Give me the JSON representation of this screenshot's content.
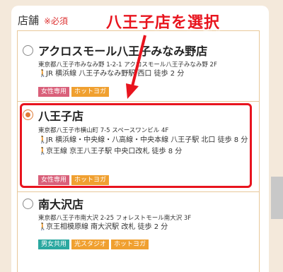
{
  "header": {
    "label": "店舗",
    "required": "※必須"
  },
  "annotation": {
    "text": "八王子店を選択",
    "color": "#e8141e"
  },
  "stores": [
    {
      "name": "アクロスモール八王子みなみ野店",
      "address": "東京都八王子市みなみ野 1-2-1 アクロスモール八王子みなみ野 2F",
      "access": [
        "JR 横浜線 八王子みなみ野駅 西口 徒歩 2 分"
      ],
      "tags": [
        {
          "label": "女性専用",
          "color": "#d9607a"
        },
        {
          "label": "ホットヨガ",
          "color": "#f0a030"
        }
      ],
      "selected": false
    },
    {
      "name": "八王子店",
      "address": "東京都八王子市横山町 7-5 スペースワンビル 4F",
      "access": [
        "JR 横浜線・中央線・八高線・中央本線 八王子駅 北口 徒歩 8 分",
        "京王線 京王八王子駅 中央口改札 徒歩 8 分"
      ],
      "tags": [
        {
          "label": "女性専用",
          "color": "#d9607a"
        },
        {
          "label": "ホットヨガ",
          "color": "#f0a030"
        }
      ],
      "selected": true
    },
    {
      "name": "南大沢店",
      "address": "東京都八王子市南大沢 2-25 フォレストモール南大沢 3F",
      "access": [
        "京王相模原線 南大沢駅 改札 徒歩 2 分"
      ],
      "tags": [
        {
          "label": "男女共用",
          "color": "#2aa8a0"
        },
        {
          "label": "光スタジオ",
          "color": "#f0a030"
        },
        {
          "label": "ホットヨガ",
          "color": "#f0a030"
        }
      ],
      "selected": false
    }
  ]
}
